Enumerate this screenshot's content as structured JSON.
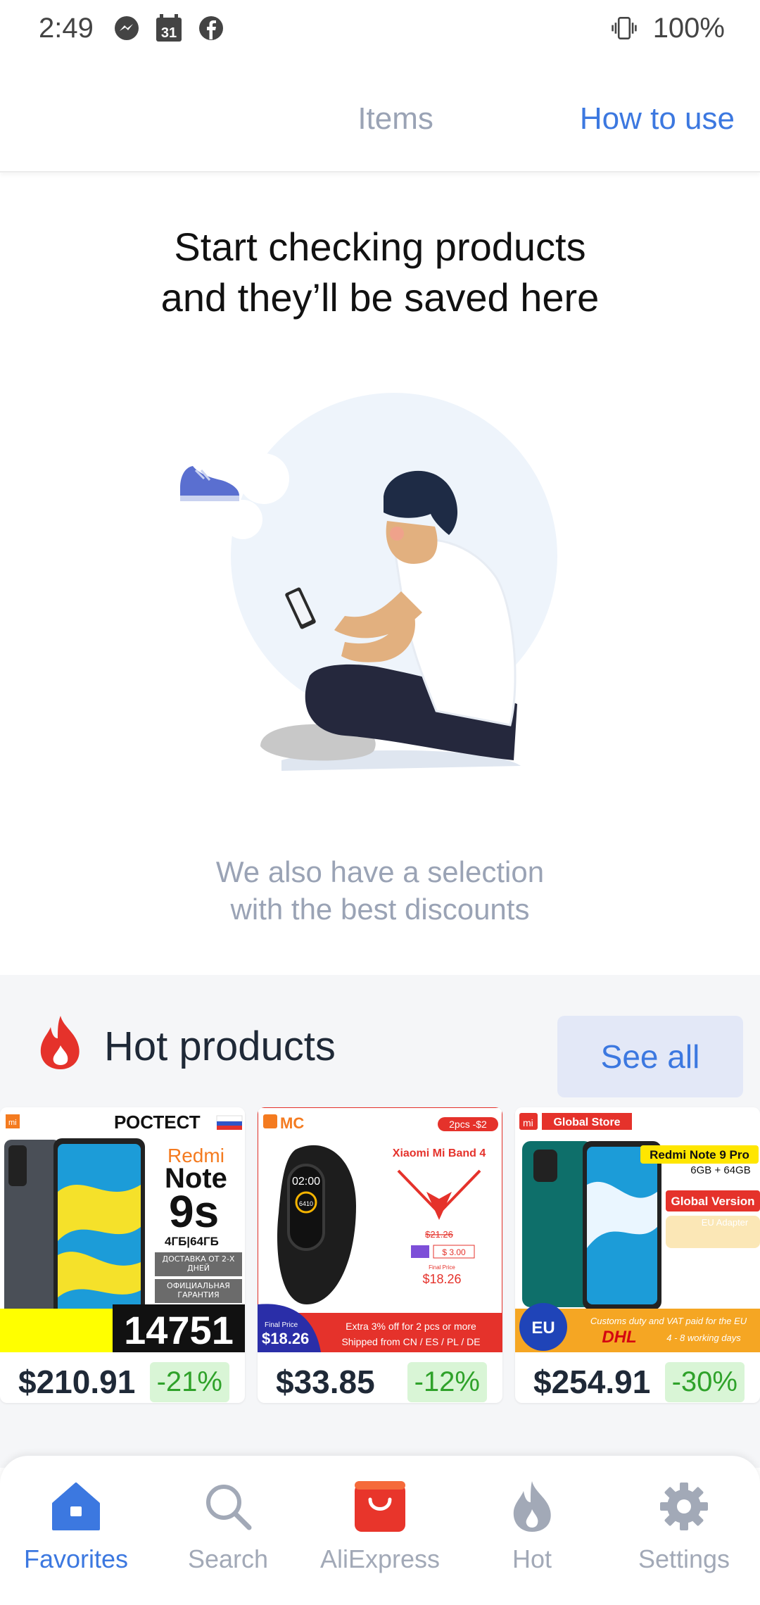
{
  "status_bar": {
    "time": "2:49",
    "calendar_day": "31",
    "battery": "100%"
  },
  "tabs": {
    "items": "Items",
    "how_to_use": "How to use"
  },
  "empty_state": {
    "title_line1": "Start checking products",
    "title_line2": "and they’ll be saved here",
    "sub_line1": "We also have a selection",
    "sub_line2": "with the best discounts"
  },
  "hot": {
    "title": "Hot products",
    "see_all": "See all",
    "products": [
      {
        "price": "$210.91",
        "discount": "-21%",
        "img": {
          "top_label": "РОСТЕСТ",
          "brand": "Redmi",
          "model1": "Note",
          "model2": "9s",
          "mem": "4ГБ|64ГБ",
          "tag1": "ДОСТАВКА ОТ 2-Х ДНЕЙ",
          "tag2": "ОФИЦИАЛЬНАЯ ГАРАНТИЯ",
          "code": "14751"
        }
      },
      {
        "price": "$33.85",
        "discount": "-12%",
        "img": {
          "store": "MC",
          "promo": "2pcs -$2",
          "name": "Xiaomi Mi Band 4",
          "old_price": "$21.26",
          "coupon": "$ 3.00",
          "final_label": "Final Price",
          "final_price": "$18.26",
          "watch_time": "02:00",
          "watch_steps": "6410",
          "banner_label": "Final Price",
          "banner_price": "$18.26",
          "banner_line1": "Extra 3% off for 2 pcs or more",
          "banner_line2": "Shipped from CN / ES / PL / DE"
        }
      },
      {
        "price": "$254.91",
        "discount": "-30%",
        "img": {
          "store": "Global Store",
          "model": "Redmi Note 9 Pro",
          "mem": "6GB + 64GB",
          "version": "Global Version",
          "adapter": "EU Adapter",
          "eu": "EU",
          "line1": "Customs duty and VAT paid for the EU",
          "carrier": "DHL",
          "line2": "4 - 8 working days"
        }
      }
    ]
  },
  "nav": {
    "favorites": "Favorites",
    "search": "Search",
    "aliexpress": "AliExpress",
    "hot": "Hot",
    "settings": "Settings"
  },
  "colors": {
    "accent": "#3c78e0",
    "muted": "#9aa3b5",
    "discount_bg": "#d9f5d6",
    "discount_text": "#2fa22a",
    "hot_red": "#e5322b"
  }
}
